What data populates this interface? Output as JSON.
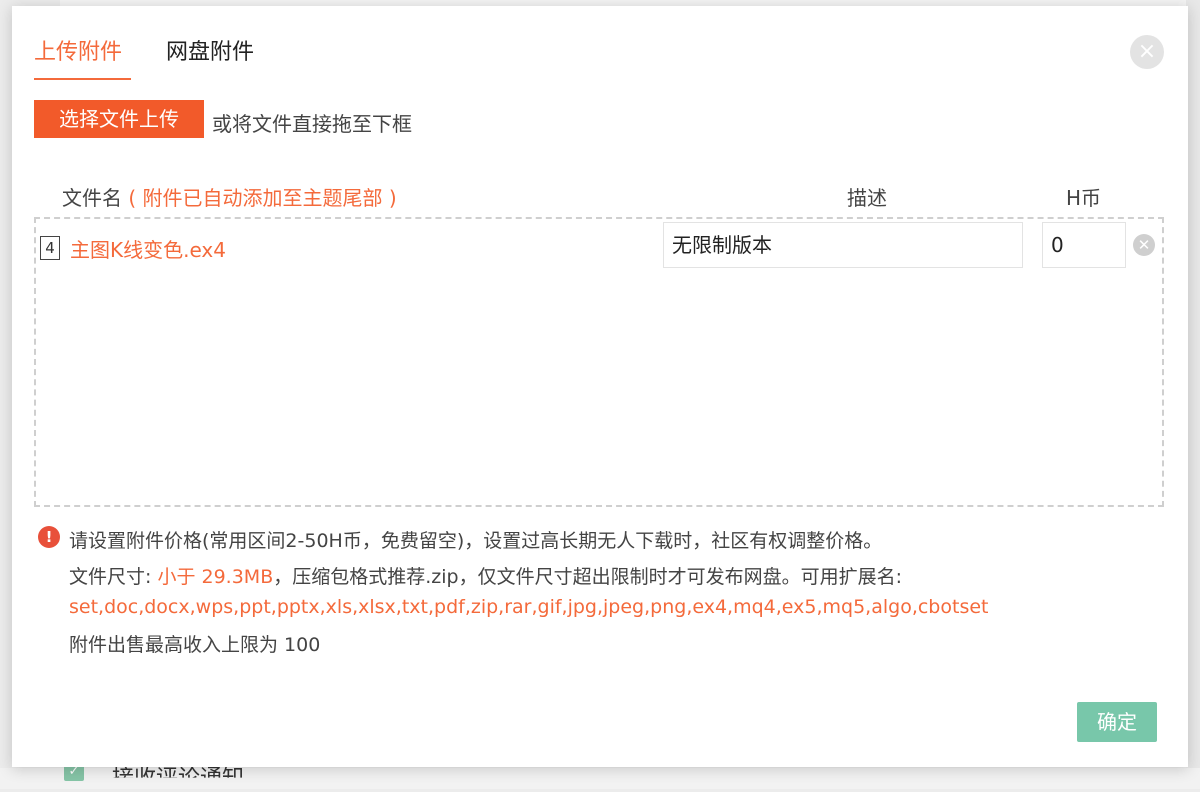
{
  "background": {
    "checkbox_label": "接收评论通知"
  },
  "dialog": {
    "tabs": [
      {
        "label": "上传附件",
        "active": true
      },
      {
        "label": "网盘附件",
        "active": false
      }
    ],
    "close_icon": "×",
    "upload_button": "选择文件上传",
    "drag_hint": "或将文件直接拖至下框",
    "columns": {
      "filename": "文件名",
      "filename_note": "( 附件已自动添加至主题尾部 )",
      "description": "描述",
      "coin": "H币"
    },
    "files": [
      {
        "icon_glyph": "4",
        "name": "主图K线变色.ex4",
        "description": "无限制版本",
        "coin": "0"
      }
    ],
    "notice": {
      "icon": "!",
      "line1": "请设置附件价格(常用区间2-50H币，免费留空)，设置过高长期无人下载时，社区有权调整价格。",
      "line2_prefix": "文件尺寸: ",
      "line2_size": "小于 29.3MB",
      "line2_suffix": "，压缩包格式推荐.zip，仅文件尺寸超出限制时才可发布网盘。可用扩展名:",
      "line3_extensions": "set,doc,docx,wps,ppt,pptx,xls,xlsx,txt,pdf,zip,rar,gif,jpg,jpeg,png,ex4,mq4,ex5,mq5,algo,cbotset",
      "line4": "附件出售最高收入上限为 100"
    },
    "confirm_button": "确定"
  },
  "colors": {
    "accent": "#f46a3b",
    "upload_button_bg": "#f25a2a",
    "confirm_button_bg": "#78c7aa",
    "notice_icon_bg": "#e8503a"
  }
}
